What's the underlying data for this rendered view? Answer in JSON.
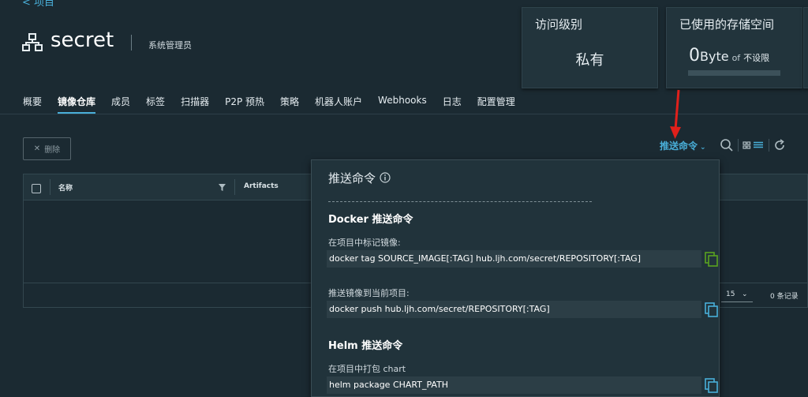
{
  "header": {
    "back_label": "< 项目",
    "project_name": "secret",
    "role": "系统管理员"
  },
  "cards": {
    "access": {
      "title": "访问级别",
      "value": "私有"
    },
    "storage": {
      "title": "已使用的存储空间",
      "amount": "0",
      "unit": "Byte",
      "of": "of",
      "limit": "不设限"
    }
  },
  "tabs": [
    {
      "label": "概要"
    },
    {
      "label": "镜像仓库"
    },
    {
      "label": "成员"
    },
    {
      "label": "标签"
    },
    {
      "label": "扫描器"
    },
    {
      "label": "P2P 预热"
    },
    {
      "label": "策略"
    },
    {
      "label": "机器人账户"
    },
    {
      "label": "Webhooks"
    },
    {
      "label": "日志"
    },
    {
      "label": "配置管理"
    }
  ],
  "toolbar": {
    "delete_label": "删除",
    "push_cmd_label": "推送命令"
  },
  "grid": {
    "col_name": "名称",
    "col_artifacts": "Artifacts",
    "page_size": "15",
    "records": "0 条记录"
  },
  "popover": {
    "title": "推送命令",
    "docker_title": "Docker 推送命令",
    "tag_label": "在项目中标记镜像:",
    "tag_cmd": "docker tag SOURCE_IMAGE[:TAG] hub.ljh.com/secret/REPOSITORY[:TAG]",
    "push_label": "推送镜像到当前项目:",
    "push_cmd": "docker push hub.ljh.com/secret/REPOSITORY[:TAG]",
    "helm_title": "Helm 推送命令",
    "helm_label": "在项目中打包 chart",
    "helm_cmd": "helm package CHART_PATH"
  },
  "colors": {
    "accent": "#49afd9",
    "arrow": "#e0201b",
    "copy_active": "#5aa220"
  }
}
